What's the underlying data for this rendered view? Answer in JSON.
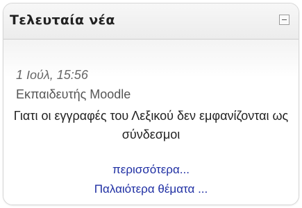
{
  "block": {
    "title": "Τελευταία νέα",
    "collapse_icon": "minus-box-icon"
  },
  "news": {
    "date": "1 Ιούλ, 15:56",
    "author": "Εκπαιδευτής Moodle",
    "text": "Γιατι οι εγγραφές του Λεξικού δεν εμφανίζονται ως σύνδεσμοι",
    "more_link": "περισσότερα...",
    "older_link": "Παλαιότερα θέματα ..."
  },
  "colors": {
    "link": "#1f2fa3",
    "date": "#666666"
  }
}
